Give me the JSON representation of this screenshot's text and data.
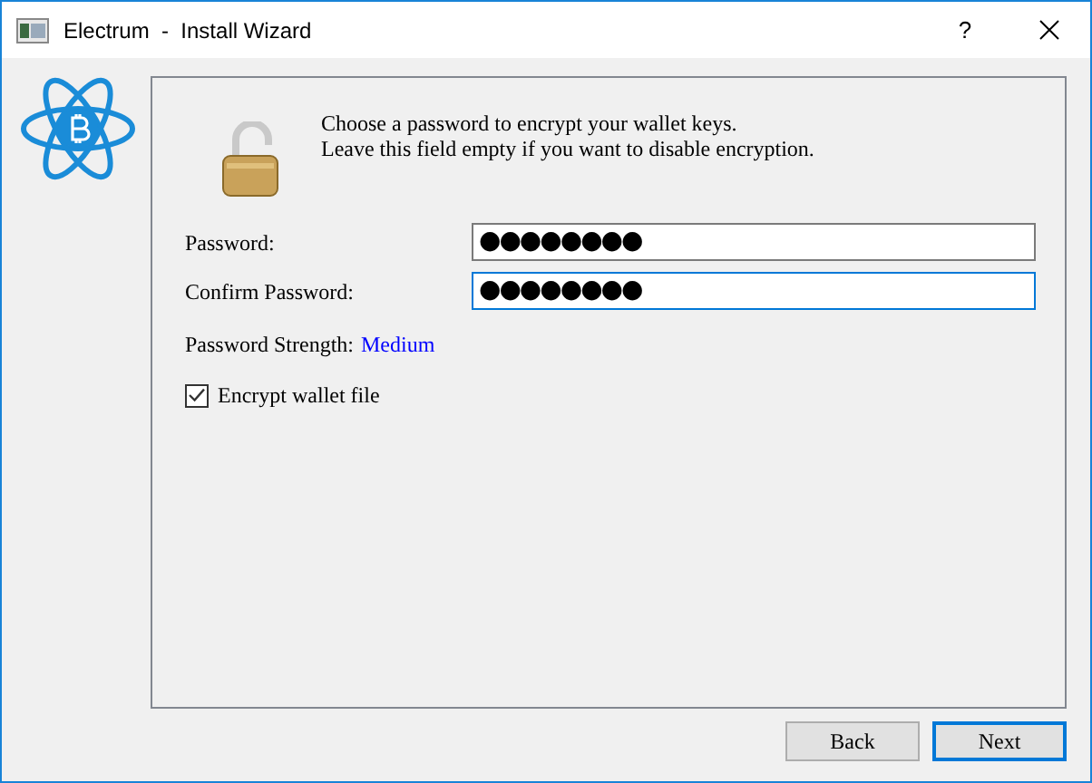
{
  "window": {
    "title": "Electrum  -  Install Wizard",
    "help": "?"
  },
  "intro": [
    "Choose a password to encrypt your wallet keys.",
    "Leave this field empty if you want to disable encryption."
  ],
  "fields": [
    {
      "label": "Password:",
      "value": "●●●●●●●●",
      "focused": false
    },
    {
      "label": "Confirm Password:",
      "value": "●●●●●●●●",
      "focused": true
    }
  ],
  "strength": {
    "label": "Password Strength:",
    "value": "Medium"
  },
  "encrypt": {
    "label": "Encrypt wallet file",
    "checked": true
  },
  "buttons": [
    {
      "label": "Back",
      "default": false
    },
    {
      "label": "Next",
      "default": true
    }
  ]
}
